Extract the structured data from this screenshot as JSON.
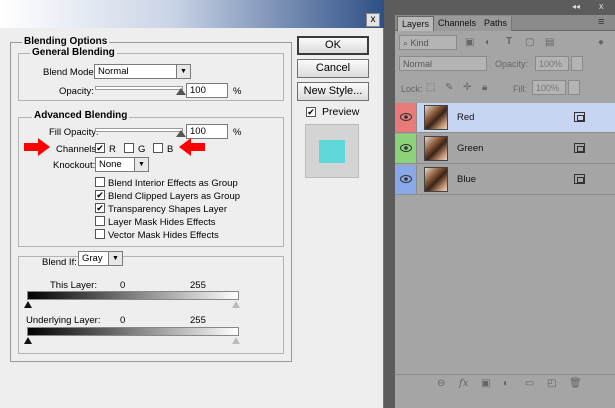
{
  "dialog": {
    "close_glyph": "x",
    "blending_options": "Blending Options",
    "general_blending": "General Blending",
    "blend_mode_label": "Blend Mode:",
    "blend_mode_value": "Normal",
    "opacity_label": "Opacity:",
    "opacity_value": "100",
    "opacity_unit": "%",
    "advanced_blending": "Advanced Blending",
    "fill_opacity_label": "Fill Opacity:",
    "fill_opacity_value": "100",
    "fill_opacity_unit": "%",
    "channels_label": "Channels:",
    "channel_r": "R",
    "channel_g": "G",
    "channel_b": "B",
    "channel_r_checked": true,
    "channel_g_checked": false,
    "channel_b_checked": false,
    "knockout_label": "Knockout:",
    "knockout_value": "None",
    "options": [
      {
        "label": "Blend Interior Effects as Group",
        "checked": false
      },
      {
        "label": "Blend Clipped Layers as Group",
        "checked": true
      },
      {
        "label": "Transparency Shapes Layer",
        "checked": true
      },
      {
        "label": "Layer Mask Hides Effects",
        "checked": false
      },
      {
        "label": "Vector Mask Hides Effects",
        "checked": false
      }
    ],
    "blend_if_label": "Blend If:",
    "blend_if_value": "Gray",
    "this_layer_label": "This Layer:",
    "this_layer_min": "0",
    "this_layer_max": "255",
    "underlying_layer_label": "Underlying Layer:",
    "underlying_layer_min": "0",
    "underlying_layer_max": "255",
    "buttons": {
      "ok": "OK",
      "cancel": "Cancel",
      "new_style": "New Style..."
    },
    "preview_label": "Preview",
    "preview_checked": true,
    "check_glyph": "✔",
    "arrow_glyph": "▼",
    "colors": {
      "preview_swatch": "#5ed8d8",
      "red_arrow": "#ff0000"
    }
  },
  "layers_panel": {
    "collapse_glyph": "◂◂",
    "close_glyph": "x",
    "tabs": [
      "Layers",
      "Channels",
      "Paths"
    ],
    "menu_glyph": "≡",
    "filter_value": "Kind",
    "blend_mode_value": "Normal",
    "opacity_label": "Opacity:",
    "opacity_value": "100%",
    "lock_label": "Lock:",
    "fill_label": "Fill:",
    "fill_value": "100%",
    "layers": [
      {
        "name": "Red",
        "color": "#e87a7a",
        "selected": true
      },
      {
        "name": "Green",
        "color": "#8cd27a",
        "selected": false
      },
      {
        "name": "Blue",
        "color": "#8aa8e8",
        "selected": false
      }
    ],
    "colors": {
      "selected_row": "#c7d4f2"
    }
  }
}
